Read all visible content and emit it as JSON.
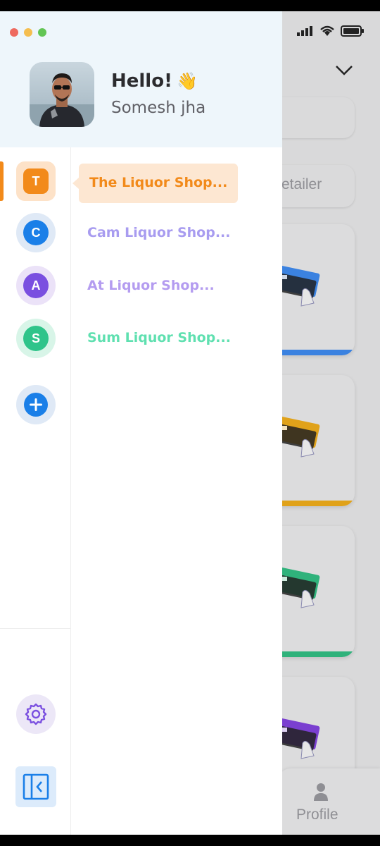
{
  "background": {
    "search_placeholder_fragment": "etailer",
    "bottom_nav": {
      "profile_label": "Profile"
    },
    "cards": [
      {
        "color": "#3b82e0"
      },
      {
        "color": "#e0a21a"
      },
      {
        "color": "#2fb27b"
      },
      {
        "color": "#7a3fd0"
      }
    ]
  },
  "drawer": {
    "greeting": "Hello!",
    "greeting_emoji": "👋",
    "user_name": "Somesh jha",
    "shops": [
      {
        "letter": "T",
        "name": "The Liquor Shop...",
        "color": "#f28a1a",
        "active": true
      },
      {
        "letter": "C",
        "name": "Cam Liquor Shop...",
        "color": "#a89cf0",
        "active": false
      },
      {
        "letter": "A",
        "name": "At Liquor Shop...",
        "color": "#b49cf0",
        "active": false
      },
      {
        "letter": "S",
        "name": "Sum Liquor Shop...",
        "color": "#5fe0b0",
        "active": false
      }
    ]
  },
  "colors": {
    "accent_orange": "#f28a1a",
    "accent_blue": "#1a7fe8",
    "accent_purple": "#7a4fe0",
    "accent_green": "#2fc48a"
  },
  "icons": {
    "add": "plus-icon",
    "settings": "gear-icon",
    "collapse": "collapse-sidebar-icon"
  }
}
